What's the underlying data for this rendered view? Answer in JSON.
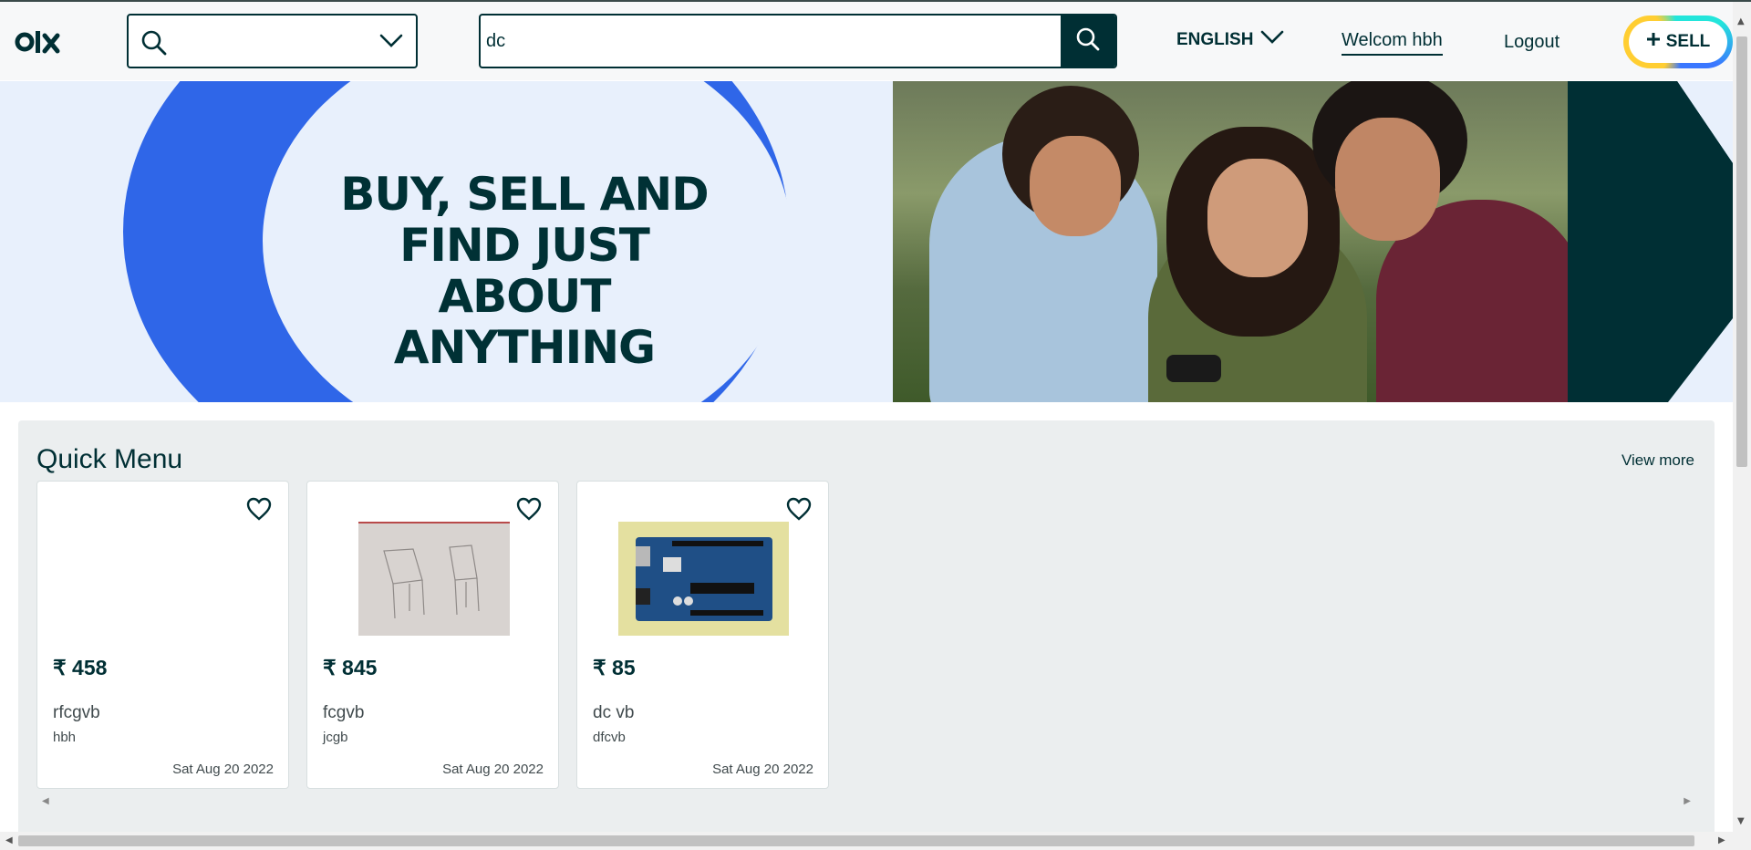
{
  "header": {
    "logo_alt": "olx",
    "location_value": "",
    "search": {
      "value": "dc",
      "placeholder": ""
    },
    "language": "ENGLISH",
    "welcome": "Welcom hbh",
    "logout": "Logout",
    "sell": "SELL"
  },
  "banner": {
    "line1": "BUY, SELL AND",
    "line2": "FIND JUST ABOUT",
    "line3": "ANYTHING"
  },
  "quick_menu": {
    "title": "Quick Menu",
    "view_more": "View more",
    "cards": [
      {
        "price": "₹ 458",
        "title": "rfcgvb",
        "subtitle": "hbh",
        "date": "Sat Aug 20 2022",
        "image": "none"
      },
      {
        "price": "₹ 845",
        "title": "fcgvb",
        "subtitle": "jcgb",
        "date": "Sat Aug 20 2022",
        "image": "chairs-sketch"
      },
      {
        "price": "₹ 85",
        "title": "dc vb",
        "subtitle": "dfcvb",
        "date": "Sat Aug 20 2022",
        "image": "arduino-board"
      }
    ]
  },
  "colors": {
    "brand_dark": "#002f34",
    "banner_blue": "#2f66e8",
    "banner_bg": "#e8f0fc",
    "panel_bg": "#ebeeef"
  },
  "icons": [
    "olx-logo-icon",
    "search-icon",
    "chevron-down-icon",
    "plus-icon",
    "heart-icon"
  ]
}
